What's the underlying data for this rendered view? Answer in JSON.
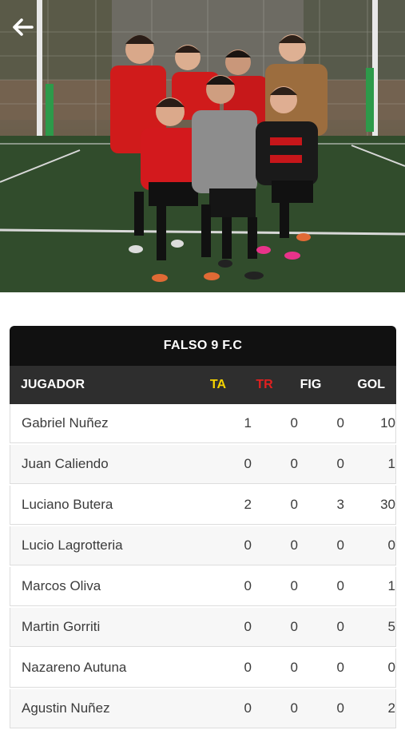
{
  "colors": {
    "ta": "#f5d300",
    "tr": "#e02020",
    "header_bg": "#111111",
    "subheader_bg": "#2e2e2e"
  },
  "nav": {
    "back_icon": "arrow-left-icon"
  },
  "hero": {
    "image": "team-photo"
  },
  "team": {
    "name": "FALSO 9 F.C",
    "columns": {
      "player": "JUGADOR",
      "ta": "TA",
      "tr": "TR",
      "fig": "FIG",
      "gol": "GOL"
    },
    "players": [
      {
        "name": "Gabriel Nuñez",
        "ta": "1",
        "tr": "0",
        "fig": "0",
        "gol": "10"
      },
      {
        "name": "Juan Caliendo",
        "ta": "0",
        "tr": "0",
        "fig": "0",
        "gol": "1"
      },
      {
        "name": "Luciano Butera",
        "ta": "2",
        "tr": "0",
        "fig": "3",
        "gol": "30"
      },
      {
        "name": "Lucio Lagrotteria",
        "ta": "0",
        "tr": "0",
        "fig": "0",
        "gol": "0"
      },
      {
        "name": "Marcos Oliva",
        "ta": "0",
        "tr": "0",
        "fig": "0",
        "gol": "1"
      },
      {
        "name": "Martin Gorriti",
        "ta": "0",
        "tr": "0",
        "fig": "0",
        "gol": "5"
      },
      {
        "name": "Nazareno Autuna",
        "ta": "0",
        "tr": "0",
        "fig": "0",
        "gol": "0"
      },
      {
        "name": "Agustin Nuñez",
        "ta": "0",
        "tr": "0",
        "fig": "0",
        "gol": "2"
      }
    ]
  }
}
